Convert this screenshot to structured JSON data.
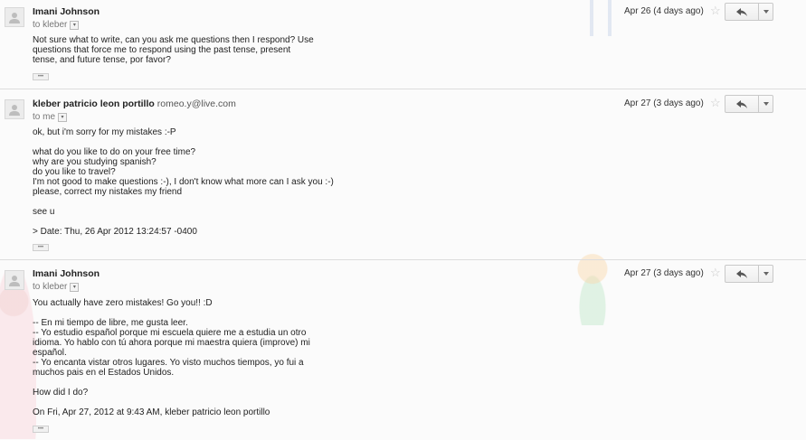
{
  "messages": [
    {
      "sender": "Imani Johnson",
      "email": "",
      "to": "to kleber",
      "date": "Apr 26 (4 days ago)",
      "body": [
        "Not sure what to write, can you ask me questions then I respond? Use",
        "questions that force me to respond using the past tense, present",
        "tense, and future tense, por favor?"
      ],
      "ellipsis": "•••"
    },
    {
      "sender": "kleber patricio leon portillo",
      "email": "romeo.y@live.com",
      "to": "to me",
      "date": "Apr 27 (3 days ago)",
      "body": [
        "ok, but i'm sorry for my mistakes :-P",
        "",
        "what do you like to do on your free time?",
        "why are you studying spanish?",
        "do you like to travel?",
        "I'm not good to make questions :-), I don't know what more can I ask you :-)",
        "please, correct my nistakes my friend",
        "",
        "see u",
        "",
        "> Date: Thu, 26 Apr 2012 13:24:57 -0400"
      ],
      "ellipsis": "•••"
    },
    {
      "sender": "Imani Johnson",
      "email": "",
      "to": "to kleber",
      "date": "Apr 27 (3 days ago)",
      "body": [
        "You actually have zero mistakes! Go you!! :D",
        "",
        "-- En mi tiempo de libre, me gusta leer.",
        "-- Yo estudio español porque mi escuela quiere me a estudia un otro",
        "idioma. Yo hablo con tú ahora porque mi maestra quiera (improve) mi",
        "español.",
        "-- Yo encanta vistar otros lugares. Yo visto muchos tiempos, yo fui a",
        "muchos pais en el Estados Unidos.",
        "",
        "How did I do?",
        "",
        "On Fri, Apr 27, 2012 at 9:43 AM, kleber patricio leon portillo"
      ],
      "ellipsis": "•••"
    }
  ],
  "icons": {
    "avatar": "person-icon",
    "star": "star-icon",
    "reply": "reply-icon",
    "more": "chevron-down-icon"
  },
  "colors": {
    "background": "#fbfbfb",
    "separator": "#dcdcdc",
    "star": "#c8c8c8"
  }
}
